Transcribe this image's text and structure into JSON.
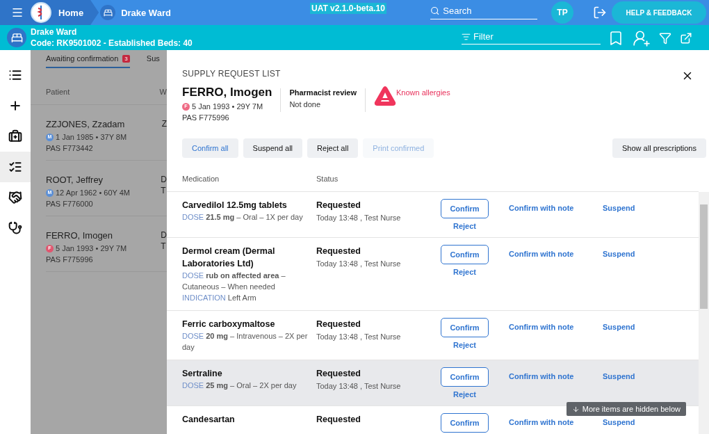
{
  "topbar": {
    "home": "Home",
    "ward": "Drake Ward",
    "version": "UAT v2.1.0-beta.10",
    "search": {
      "placeholder": "Search"
    },
    "avatar": "TP",
    "help": "HELP & FEEDBACK"
  },
  "ward_bar": {
    "name": "Drake Ward",
    "details": "Code: RK9501002 - Established Beds: 40",
    "filter": {
      "placeholder": "Filter"
    }
  },
  "sidebar": {
    "items": [
      {
        "kind": "list",
        "selected": false
      },
      {
        "kind": "add",
        "selected": false
      },
      {
        "kind": "medical",
        "selected": false
      },
      {
        "kind": "checklist",
        "selected": true
      },
      {
        "kind": "handshake",
        "selected": false
      },
      {
        "kind": "stethoscope",
        "selected": false
      }
    ]
  },
  "background_list": {
    "tabs": [
      {
        "label": "Awaiting confirmation",
        "badge": "3",
        "selected": true
      },
      {
        "label": "Sus",
        "selected": false
      }
    ],
    "columns": [
      "Patient",
      "W"
    ],
    "patients": [
      {
        "name": "ZZJONES, Zzadam",
        "sex": "M",
        "color": "#5b8fd6",
        "dob": "1 Jan 1985 • 37Y 8M",
        "pas": "PAS F773442",
        "column_2": [
          "Z"
        ]
      },
      {
        "name": "ROOT, Jeffrey",
        "sex": "M",
        "color": "#5b8fd6",
        "dob": "12 Apr 1962 • 60Y 4M",
        "pas": "PAS F776000",
        "column_2": [
          "D",
          "T"
        ]
      },
      {
        "name": "FERRO, Imogen",
        "sex": "F",
        "color": "#e0566f",
        "dob": "5 Jan 1993 • 29Y 7M",
        "pas": "PAS F775996",
        "column_2": [
          "D",
          "T"
        ]
      }
    ]
  },
  "modal": {
    "title": "SUPPLY REQUEST LIST",
    "patient": {
      "name": "FERRO, Imogen",
      "sex": "F",
      "color": "#ef6b85",
      "dob": "5 Jan 1993 • 29Y 7M",
      "pas": "PAS F775996"
    },
    "review": {
      "label": "Pharmacist review",
      "value": "Not done"
    },
    "allergies": "Known allergies",
    "buttons": [
      {
        "label": "Confirm all",
        "kind": "primary",
        "disabled": false
      },
      {
        "label": "Suspend all",
        "kind": "default",
        "disabled": false
      },
      {
        "label": "Reject all",
        "kind": "default",
        "disabled": false
      },
      {
        "label": "Print confirmed",
        "kind": "primary",
        "disabled": true
      }
    ],
    "show_all": "Show all prescriptions",
    "columns": [
      "Medication",
      "Status"
    ],
    "rows": [
      {
        "name": "Carvedilol 12.5mg tablets",
        "details": [
          {
            "label": "DOSE",
            "text": "**21.5 mg** – Oral – 1X per day"
          }
        ],
        "status": "Requested",
        "status_meta": "Today 13:48 , Test Nurse",
        "selected": false,
        "confirm": "Confirm",
        "reject": "Reject",
        "confirm_note": "Confirm with note",
        "suspend": "Suspend"
      },
      {
        "name": "Dermol cream (Dermal Laboratories Ltd)",
        "details": [
          {
            "label": "DOSE",
            "text": "**rub on affected area** – Cutaneous – When needed"
          },
          {
            "label": "INDICATION",
            "text": "Left Arm"
          }
        ],
        "status": "Requested",
        "status_meta": "Today 13:48 , Test Nurse",
        "selected": false,
        "confirm": "Confirm",
        "reject": "Reject",
        "confirm_note": "Confirm with note",
        "suspend": "Suspend"
      },
      {
        "name": "Ferric carboxymaltose",
        "details": [
          {
            "label": "DOSE",
            "text": "**20 mg** – Intravenous – 2X per day"
          }
        ],
        "status": "Requested",
        "status_meta": "Today 13:48 , Test Nurse",
        "selected": false,
        "confirm": "Confirm",
        "reject": "Reject",
        "confirm_note": "Confirm with note",
        "suspend": "Suspend"
      },
      {
        "name": "Sertraline",
        "details": [
          {
            "label": "DOSE",
            "text": "**25 mg** – Oral – 2X per day"
          }
        ],
        "status": "Requested",
        "status_meta": "Today 13:48 , Test Nurse",
        "selected": true,
        "confirm": "Confirm",
        "reject": "Reject",
        "confirm_note": "Confirm with note",
        "suspend": "Suspend"
      },
      {
        "name": "Candesartan",
        "details": [],
        "status": "Requested",
        "selected": false,
        "confirm": "Confirm",
        "confirm_note": "Confirm with note",
        "suspend": "Suspend"
      }
    ],
    "more_hint": "More items are hidden below"
  }
}
